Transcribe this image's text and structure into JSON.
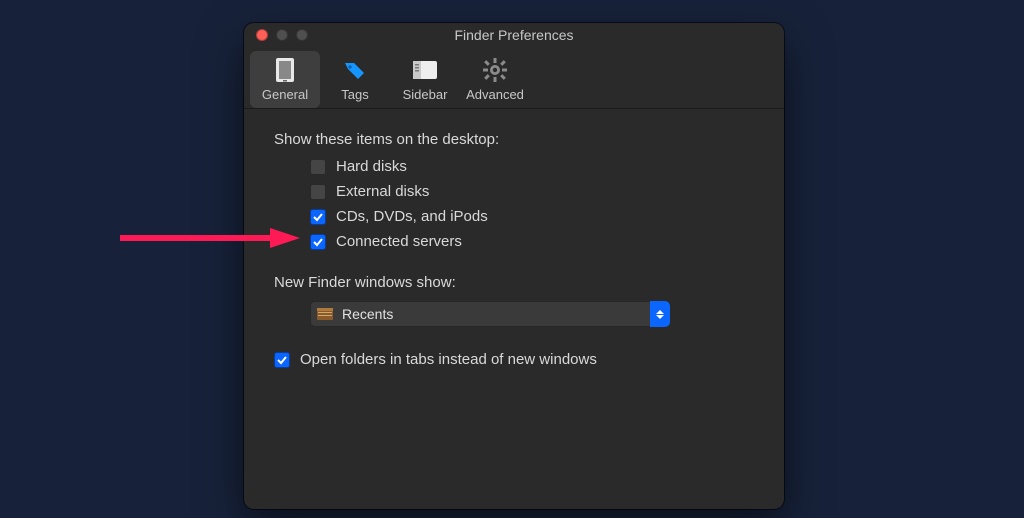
{
  "window": {
    "title": "Finder Preferences"
  },
  "toolbar": {
    "general": "General",
    "tags": "Tags",
    "sidebar": "Sidebar",
    "advanced": "Advanced"
  },
  "sections": {
    "desktop_label": "Show these items on the desktop:",
    "new_windows_label": "New Finder windows show:"
  },
  "desktop_items": {
    "hard_disks": "Hard disks",
    "external_disks": "External disks",
    "cds_dvds_ipods": "CDs, DVDs, and iPods",
    "connected_servers": "Connected servers"
  },
  "new_finder_select": {
    "value": "Recents"
  },
  "open_in_tabs": "Open folders in tabs instead of new windows"
}
